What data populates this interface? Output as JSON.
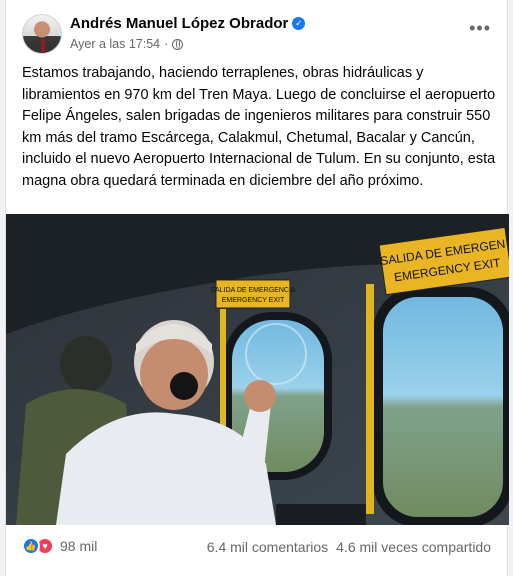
{
  "post": {
    "author": "Andrés Manuel López Obrador",
    "timestamp": "Ayer a las 17:54",
    "more_icon": "more-horizontal-icon",
    "text": "Estamos trabajando, haciendo terraplenes, obras hidráulicas y libramientos en 970 km del Tren Maya. Luego de concluirse el aeropuerto Felipe Ángeles, salen brigadas de ingenieros militares para construir 550 km más del tramo Escárcega, Calakmul, Chetumal, Bacalar y Cancún, incluido el nuevo Aeropuerto Internacional de Tulum. En su conjunto, esta magna obra quedará terminada en diciembre del año próximo."
  },
  "photo": {
    "sign_left_line1": "SALIDA DE EMERGENCIA",
    "sign_left_line2": "EMERGENCY EXIT",
    "sign_right_line1": "SALIDA DE EMERGEN",
    "sign_right_line2": "EMERGENCY EXIT"
  },
  "footer": {
    "reactions_count": "98 mil",
    "comments": "6.4 mil comentarios",
    "shares": "4.6 mil veces compartido"
  },
  "colors": {
    "accent": "#1877f2",
    "love": "#f33e58",
    "secondary_text": "#65676b"
  }
}
